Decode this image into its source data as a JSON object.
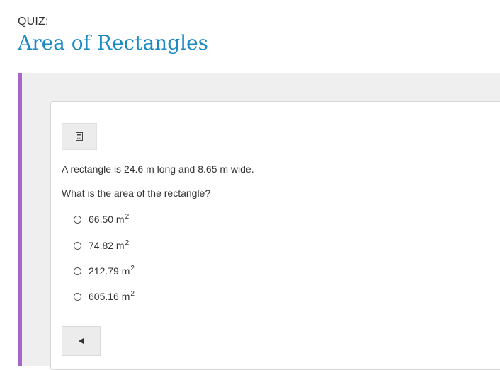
{
  "header": {
    "label": "QUIZ:",
    "title": "Area of Rectangles"
  },
  "colors": {
    "accent_bar": "#a666c7",
    "title": "#1a8bc2"
  },
  "toolbar": {
    "calculator_icon": "calculator-icon"
  },
  "question": {
    "prompt": "A rectangle is 24.6 m long and 8.65 m wide.",
    "ask": "What is the area of the rectangle?"
  },
  "choices": [
    {
      "value": "66.50 m",
      "unit_power": "2",
      "selected": false
    },
    {
      "value": "74.82 m",
      "unit_power": "2",
      "selected": false
    },
    {
      "value": "212.79 m",
      "unit_power": "2",
      "selected": false
    },
    {
      "value": "605.16 m",
      "unit_power": "2",
      "selected": false
    }
  ],
  "navigation": {
    "previous_icon": "previous-arrow-icon"
  }
}
